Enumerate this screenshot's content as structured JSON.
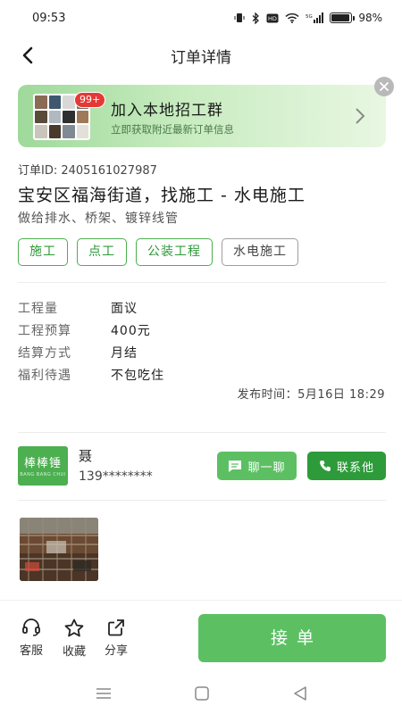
{
  "status_bar": {
    "time": "09:53",
    "battery_percent": "98%",
    "icons": [
      "vibrate-icon",
      "bluetooth-icon",
      "hd-icon",
      "wifi-icon",
      "5g-signal-icon",
      "battery-icon"
    ]
  },
  "header": {
    "title": "订单详情",
    "back_icon": "chevron-left-icon"
  },
  "banner": {
    "title": "加入本地招工群",
    "subtitle": "立即获取附近最新订单信息",
    "badge": "99+",
    "arrow_icon": "chevron-right-icon",
    "close_icon": "close-icon"
  },
  "order": {
    "id_text": "订单ID: 2405161027987",
    "title": "宝安区福海街道，找施工 - 水电施工",
    "description": "做给排水、桥架、镀锌线管",
    "tags": [
      {
        "label": "施工",
        "style": "green"
      },
      {
        "label": "点工",
        "style": "green"
      },
      {
        "label": "公装工程",
        "style": "green"
      },
      {
        "label": "水电施工",
        "style": "grey"
      }
    ],
    "details": [
      {
        "label": "工程量",
        "value": "面议"
      },
      {
        "label": "工程预算",
        "value": "400元"
      },
      {
        "label": "结算方式",
        "value": "月结"
      },
      {
        "label": "福利待遇",
        "value": "不包吃住"
      }
    ],
    "publish_time": "发布时间：5月16日 18:29"
  },
  "contact": {
    "logo_text": "棒棒锤",
    "logo_sub": "BANG BANG CHUI",
    "name": "聂",
    "phone": "139********",
    "chat_label": "聊一聊",
    "chat_icon": "chat-bubble-icon",
    "call_label": "联系他",
    "call_icon": "phone-icon"
  },
  "bottom_bar": {
    "service_label": "客服",
    "service_icon": "headset-icon",
    "favorite_label": "收藏",
    "favorite_icon": "star-icon",
    "share_label": "分享",
    "share_icon": "share-icon",
    "accept_label": "接单"
  },
  "nav_bar": {
    "icons": [
      "menu-icon",
      "home-icon",
      "back-triangle-icon"
    ]
  },
  "colors": {
    "accent": "#5cc063",
    "accent_dark": "#2e9b3a",
    "badge": "#e53935"
  }
}
